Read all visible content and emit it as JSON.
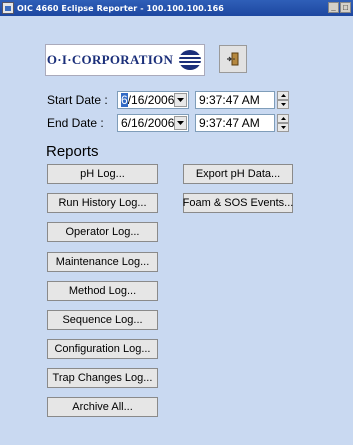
{
  "window": {
    "title": "OIC 4660 Eclipse Reporter - 100.100.100.166",
    "minimize": "_",
    "maximize": "□"
  },
  "logo": {
    "text": "O·I·CORPORATION"
  },
  "start_date": {
    "label": "Start Date :",
    "date_first_char": "6",
    "date_rest": "/16/2006",
    "time": "9:37:47 AM"
  },
  "end_date": {
    "label": "End Date :",
    "date": "6/16/2006",
    "time": "9:37:47 AM"
  },
  "reports": {
    "title": "Reports",
    "left_buttons": [
      "pH Log...",
      "Run History Log...",
      "Operator Log...",
      "Maintenance Log...",
      "Method Log...",
      "Sequence Log...",
      "Configuration Log...",
      "Trap Changes Log...",
      "Archive All..."
    ],
    "right_buttons": [
      "Export pH Data...",
      "Foam & SOS Events..."
    ]
  },
  "icons": {
    "app": "app-icon",
    "exit": "exit-door-icon",
    "globe": "globe-logo-icon"
  }
}
